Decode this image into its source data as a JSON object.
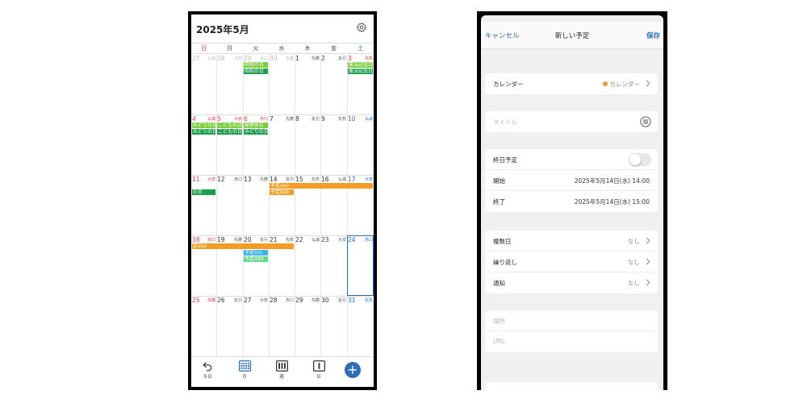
{
  "calendar": {
    "title": "2025年5月",
    "weekdays": [
      "日",
      "月",
      "火",
      "水",
      "木",
      "金",
      "土"
    ],
    "weeks": [
      [
        {
          "num": "27",
          "rk": "仏滅",
          "style": "grey"
        },
        {
          "num": "28",
          "rk": "大安",
          "style": "grey"
        },
        {
          "num": "29",
          "rk": "赤口",
          "style": "grey"
        },
        {
          "num": "30",
          "rk": "先勝",
          "style": "grey"
        },
        {
          "num": "1",
          "rk": "先勝",
          "style": ""
        },
        {
          "num": "2",
          "rk": "友引",
          "style": ""
        },
        {
          "num": "3",
          "rk": "先負",
          "style": "sun"
        }
      ],
      [
        {
          "num": "4",
          "rk": "仏滅",
          "style": "sun"
        },
        {
          "num": "5",
          "rk": "大安",
          "style": "sun"
        },
        {
          "num": "6",
          "rk": "赤口",
          "style": "sun"
        },
        {
          "num": "7",
          "rk": "先勝",
          "style": ""
        },
        {
          "num": "8",
          "rk": "友引",
          "style": ""
        },
        {
          "num": "9",
          "rk": "先負",
          "style": ""
        },
        {
          "num": "10",
          "rk": "仏滅",
          "style": "sat"
        }
      ],
      [
        {
          "num": "11",
          "rk": "大安",
          "style": "sun"
        },
        {
          "num": "12",
          "rk": "赤口",
          "style": ""
        },
        {
          "num": "13",
          "rk": "先勝",
          "style": ""
        },
        {
          "num": "14",
          "rk": "友引",
          "style": ""
        },
        {
          "num": "15",
          "rk": "先負",
          "style": ""
        },
        {
          "num": "16",
          "rk": "仏滅",
          "style": ""
        },
        {
          "num": "17",
          "rk": "大安",
          "style": "sat"
        }
      ],
      [
        {
          "num": "18",
          "rk": "赤口",
          "style": "sun"
        },
        {
          "num": "19",
          "rk": "先勝",
          "style": ""
        },
        {
          "num": "20",
          "rk": "友引",
          "style": ""
        },
        {
          "num": "21",
          "rk": "先負",
          "style": ""
        },
        {
          "num": "22",
          "rk": "仏滅",
          "style": ""
        },
        {
          "num": "23",
          "rk": "大安",
          "style": ""
        },
        {
          "num": "24",
          "rk": "赤口",
          "style": "sat"
        }
      ],
      [
        {
          "num": "25",
          "rk": "先勝",
          "style": "sun"
        },
        {
          "num": "26",
          "rk": "友引",
          "style": ""
        },
        {
          "num": "27",
          "rk": "大安",
          "style": ""
        },
        {
          "num": "28",
          "rk": "赤口",
          "style": ""
        },
        {
          "num": "29",
          "rk": "先勝",
          "style": ""
        },
        {
          "num": "30",
          "rk": "友引",
          "style": ""
        },
        {
          "num": "31",
          "rk": "先負",
          "style": "sat"
        }
      ]
    ],
    "events": [
      {
        "label": "昭和の日",
        "week": 0,
        "col": 2,
        "span": 1,
        "lane": 0,
        "color": "#7ccd3a"
      },
      {
        "label": "昭和の日",
        "week": 0,
        "col": 2,
        "span": 1,
        "lane": 1,
        "color": "#1a9e4a"
      },
      {
        "label": "憲法記念日",
        "week": 0,
        "col": 6,
        "span": 1,
        "lane": 0,
        "color": "#7ccd3a"
      },
      {
        "label": "憲法記念日",
        "week": 0,
        "col": 6,
        "span": 1,
        "lane": 1,
        "color": "#1a9e4a"
      },
      {
        "label": "みどりの日",
        "week": 1,
        "col": 0,
        "span": 1,
        "lane": 0,
        "color": "#7ccd3a"
      },
      {
        "label": "みどりの日",
        "week": 1,
        "col": 0,
        "span": 1,
        "lane": 1,
        "color": "#1a9e4a"
      },
      {
        "label": "こどもの日",
        "week": 1,
        "col": 1,
        "span": 1,
        "lane": 0,
        "color": "#7ccd3a"
      },
      {
        "label": "こどもの日",
        "week": 1,
        "col": 1,
        "span": 1,
        "lane": 1,
        "color": "#1a9e4a"
      },
      {
        "label": "振替休日",
        "week": 1,
        "col": 2,
        "span": 1,
        "lane": 0,
        "color": "#7ccd3a"
      },
      {
        "label": "みどりの日",
        "week": 1,
        "col": 2,
        "span": 1,
        "lane": 1,
        "color": "#1a9e4a"
      },
      {
        "label": "の日",
        "week": 2,
        "col": 0,
        "span": 1,
        "lane": 1,
        "color": "#1a9e4a"
      },
      {
        "label": "予定aaa",
        "week": 2,
        "col": 3,
        "span": 4,
        "lane": 0,
        "color": "#f29d25"
      },
      {
        "label": "予定bbb",
        "week": 2,
        "col": 3,
        "span": 1,
        "lane": 1,
        "color": "#f29d25"
      },
      {
        "label": "定aaa",
        "week": 3,
        "col": 0,
        "span": 4,
        "lane": 0,
        "color": "#f29d25"
      },
      {
        "label": "予定ccc",
        "week": 3,
        "col": 2,
        "span": 1,
        "lane": 1,
        "color": "#3cb4e8"
      },
      {
        "label": "予定ddd",
        "week": 3,
        "col": 2,
        "span": 1,
        "lane": 2,
        "color": "#6cd48a"
      }
    ],
    "today": {
      "week": 3,
      "col": 6
    },
    "tabs": [
      {
        "name": "today",
        "label": "今日"
      },
      {
        "name": "month",
        "label": "月"
      },
      {
        "name": "week",
        "label": "週"
      },
      {
        "name": "day",
        "label": "日"
      }
    ],
    "accent": "#2f6db6"
  },
  "form": {
    "cancel": "キャンセル",
    "title": "新しい予定",
    "save": "保存",
    "calendar_label": "カレンダー",
    "calendar_value": "カレンダー",
    "calendar_color": "#f29d25",
    "title_placeholder": "タイトル",
    "allday_label": "終日予定",
    "allday_on": false,
    "start_label": "開始",
    "start_value": "2025年5月14日(水) 14:00",
    "end_label": "終了",
    "end_value": "2025年5月14日(水) 15:00",
    "multiday_label": "複数日",
    "multiday_value": "なし",
    "repeat_label": "繰り返し",
    "repeat_value": "なし",
    "notify_label": "通知",
    "notify_value": "なし",
    "location_placeholder": "場所",
    "url_placeholder": "URL"
  }
}
